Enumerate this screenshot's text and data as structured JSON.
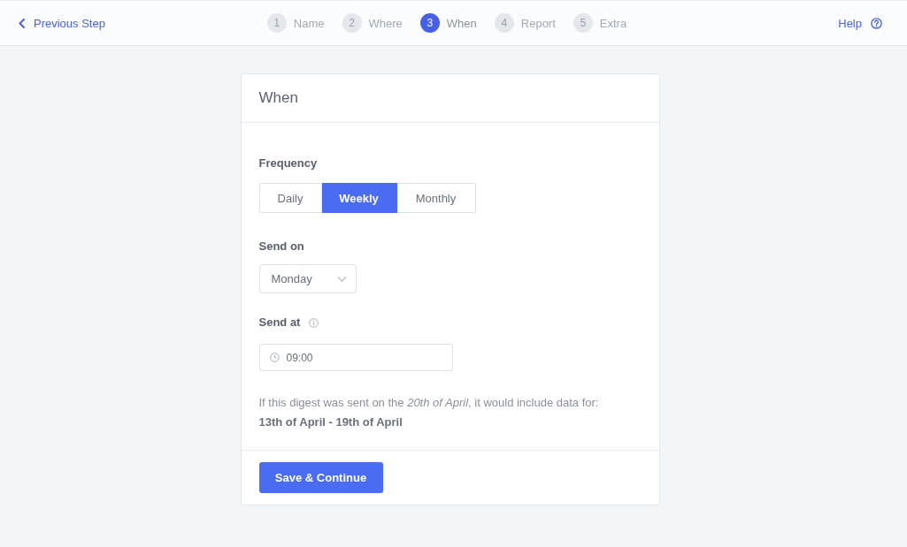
{
  "top_bar": {
    "back_link": "Previous Step",
    "steps": [
      {
        "number": "1",
        "label": "Name",
        "selected": false
      },
      {
        "number": "2",
        "label": "Where",
        "selected": false
      },
      {
        "number": "3",
        "label": "When",
        "selected": true
      },
      {
        "number": "4",
        "label": "Report",
        "selected": false
      },
      {
        "number": "5",
        "label": "Extra",
        "selected": false
      }
    ],
    "help_link": "Help"
  },
  "card": {
    "title": "When",
    "frequency": {
      "label": "Frequency",
      "options": [
        {
          "label": "Daily",
          "selected": false
        },
        {
          "label": "Weekly",
          "selected": true
        },
        {
          "label": "Monthly",
          "selected": false
        }
      ]
    },
    "send_on": {
      "label": "Send on",
      "value": "Monday"
    },
    "send_at": {
      "label": "Send at",
      "value": "09:00"
    },
    "summary": "If this digest was sent on the *20th of April*, it would include data for:",
    "range": "13th of April - 19th of April",
    "submit_button": "Save & Continue"
  }
}
